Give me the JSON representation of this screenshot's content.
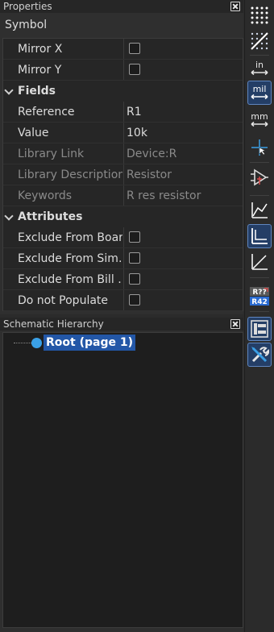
{
  "properties_panel": {
    "title": "Properties",
    "symbol_label": "Symbol",
    "rows": [
      {
        "kind": "check",
        "name": "Mirror X"
      },
      {
        "kind": "check",
        "name": "Mirror Y"
      },
      {
        "kind": "category",
        "name": "Fields"
      },
      {
        "kind": "field",
        "name": "Reference",
        "value": "R1"
      },
      {
        "kind": "field",
        "name": "Value",
        "value": "10k"
      },
      {
        "kind": "field_dim",
        "name": "Library Link",
        "value": "Device:R"
      },
      {
        "kind": "field_dim",
        "name": "Library Description",
        "value": "Resistor"
      },
      {
        "kind": "field_dim",
        "name": "Keywords",
        "value": "R res resistor"
      },
      {
        "kind": "category",
        "name": "Attributes"
      },
      {
        "kind": "check",
        "name": "Exclude From Board"
      },
      {
        "kind": "check",
        "name": "Exclude From Sim…"
      },
      {
        "kind": "check",
        "name": "Exclude From Bill …"
      },
      {
        "kind": "check",
        "name": "Do not Populate"
      }
    ]
  },
  "hierarchy_panel": {
    "title": "Schematic Hierarchy",
    "root_label": "Root (page 1)"
  },
  "toolbar": {
    "units_in": "in",
    "units_mil": "mil",
    "units_mm": "mm",
    "annotate_top": "R??",
    "annotate_bottom": "R42",
    "buttons": [
      {
        "icon": "grid-dots-icon",
        "active": true
      },
      {
        "icon": "grid-overrides-icon",
        "active": true
      },
      {
        "icon": "units-inches-icon",
        "active": false
      },
      {
        "icon": "units-mils-icon",
        "active": true
      },
      {
        "icon": "units-millimeters-icon",
        "active": false
      },
      {
        "icon": "cursor-crosshair-icon",
        "active": false
      },
      {
        "icon": "hidden-pins-icon",
        "active": false
      },
      {
        "icon": "line-mode-free-icon",
        "active": false
      },
      {
        "icon": "line-mode-90-icon",
        "active": true
      },
      {
        "icon": "line-mode-45-icon",
        "active": false
      },
      {
        "icon": "annotate-icon",
        "active": false
      },
      {
        "icon": "hierarchy-navigator-icon",
        "active": true
      },
      {
        "icon": "properties-manager-icon",
        "active": true
      }
    ]
  }
}
